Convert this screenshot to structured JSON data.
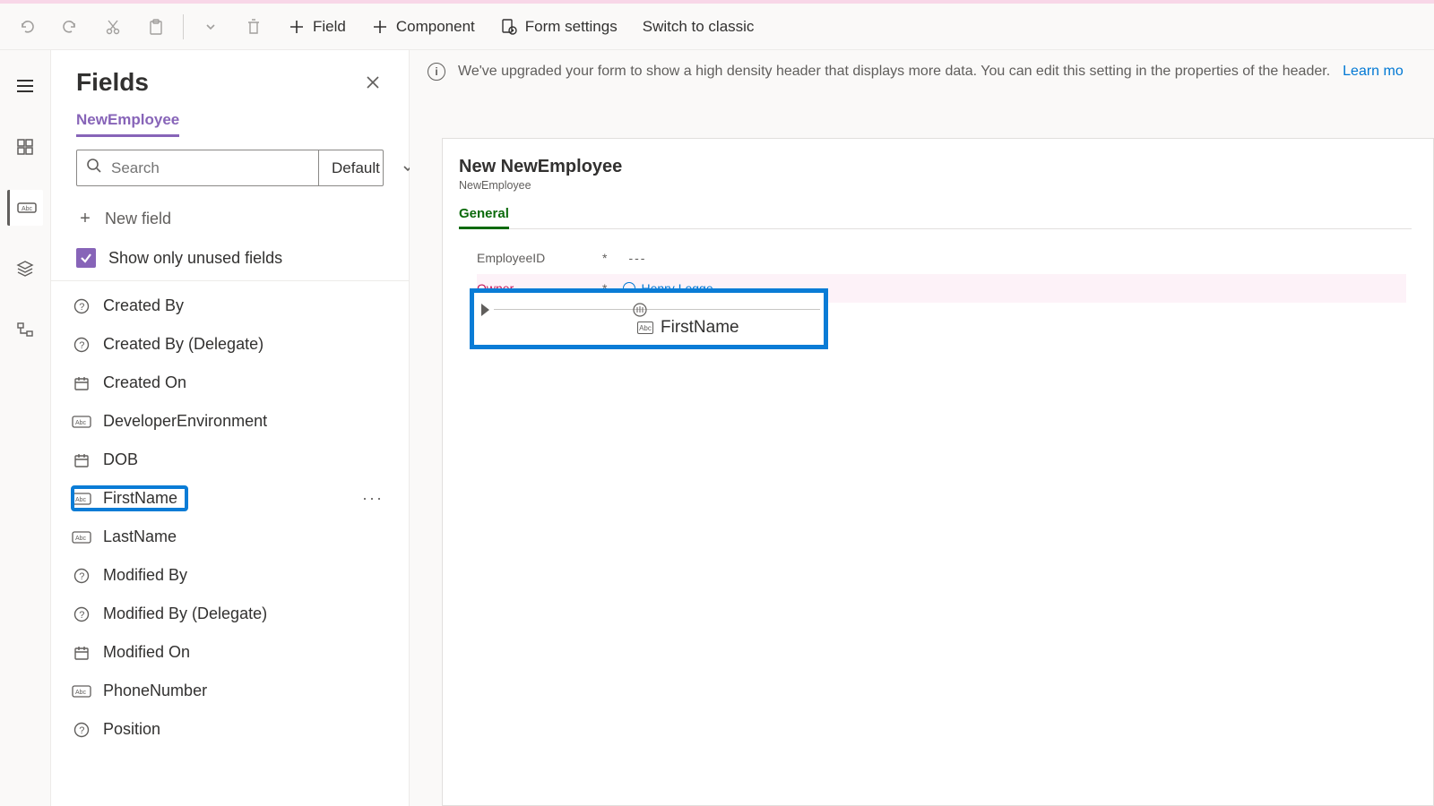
{
  "commandBar": {
    "undo": "Undo",
    "redo": "Redo",
    "cut": "Cut",
    "paste": "Paste",
    "delete": "Delete",
    "field": "Field",
    "component": "Component",
    "formSettings": "Form settings",
    "switchClassic": "Switch to classic"
  },
  "panel": {
    "title": "Fields",
    "entity": "NewEmployee",
    "searchPlaceholder": "Search",
    "filter": "Default",
    "newField": "New field",
    "showUnused": "Show only unused fields"
  },
  "fields": [
    {
      "name": "Created By",
      "icon": "question"
    },
    {
      "name": "Created By (Delegate)",
      "icon": "question"
    },
    {
      "name": "Created On",
      "icon": "calendar"
    },
    {
      "name": "DeveloperEnvironment",
      "icon": "text"
    },
    {
      "name": "DOB",
      "icon": "calendar"
    },
    {
      "name": "FirstName",
      "icon": "text",
      "highlighted": true,
      "showMore": true
    },
    {
      "name": "LastName",
      "icon": "text"
    },
    {
      "name": "Modified By",
      "icon": "question"
    },
    {
      "name": "Modified By (Delegate)",
      "icon": "question"
    },
    {
      "name": "Modified On",
      "icon": "calendar"
    },
    {
      "name": "PhoneNumber",
      "icon": "text"
    },
    {
      "name": "Position",
      "icon": "question"
    }
  ],
  "infoBar": {
    "message": "We've upgraded your form to show a high density header that displays more data. You can edit this setting in the properties of the header.",
    "link": "Learn mo"
  },
  "form": {
    "title": "New NewEmployee",
    "subtitle": "NewEmployee",
    "tab": "General",
    "rows": {
      "employeeId": {
        "label": "EmployeeID",
        "value": "---"
      },
      "owner": {
        "label": "Owner",
        "value": "Henry Legge"
      }
    },
    "dropLabel": "FirstName"
  }
}
